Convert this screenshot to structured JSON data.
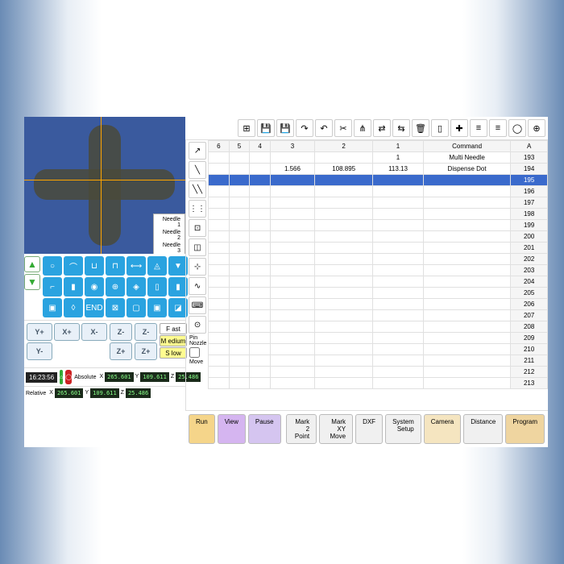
{
  "needle_options": [
    "Needle 1",
    "Needle 2",
    "Needle 3"
  ],
  "columns": {
    "a": "A",
    "cmd": "Command",
    "c1": "1",
    "c2": "2",
    "c3": "3",
    "c4": "4",
    "c5": "5",
    "c6": "6"
  },
  "rows": [
    {
      "n": "193",
      "cmd": "Multi Needle",
      "v1": "1"
    },
    {
      "n": "194",
      "cmd": "Dispense Dot",
      "v1": "113.13",
      "v2": "108.895",
      "v3": "1.566"
    },
    {
      "n": "195",
      "sel": true
    },
    {
      "n": "196"
    },
    {
      "n": "197"
    },
    {
      "n": "198"
    },
    {
      "n": "199"
    },
    {
      "n": "200"
    },
    {
      "n": "201"
    },
    {
      "n": "202"
    },
    {
      "n": "203"
    },
    {
      "n": "204"
    },
    {
      "n": "205"
    },
    {
      "n": "206"
    },
    {
      "n": "207"
    },
    {
      "n": "208"
    },
    {
      "n": "209"
    },
    {
      "n": "210"
    },
    {
      "n": "211"
    },
    {
      "n": "212"
    },
    {
      "n": "213"
    }
  ],
  "jog": {
    "xplus": "X+",
    "xminus": "X-",
    "yplus": "Y+",
    "yminus": "Y-",
    "zplus": "Z+",
    "zminus": "Z-"
  },
  "speed": {
    "f": "F ast",
    "m": "M edium",
    "s": "S low"
  },
  "options": {
    "pin": "Pin Nozzle",
    "move": "Move",
    "rel": "Relative",
    "abs": "Absolute"
  },
  "coords": {
    "x1": "265.601",
    "y1": "109.611",
    "z1": "25.486",
    "x2": "265.601",
    "y2": "109.611",
    "z2": "25.486"
  },
  "clock": "16:23:56",
  "toolbar_icons": [
    "⊕",
    "◯",
    "≡",
    "≡",
    "✚",
    "▯",
    "🗑",
    "⇆",
    "⇄",
    "⋔",
    "✂",
    "↶",
    "↷",
    "💾",
    "💾",
    "⊞"
  ],
  "side_icons": [
    "↗",
    "╲",
    "╲╲",
    "⋮⋮",
    "⊡",
    "◫",
    "⊹",
    "∿",
    "⌨",
    "⊙"
  ],
  "tool_icons": [
    "○",
    "⌒",
    "⊔",
    "⊓",
    "⟷",
    "◬",
    "▼",
    "⌐",
    "▮",
    "◉",
    "⊕",
    "◈",
    "▯",
    "▮",
    "▣",
    "◊",
    "END",
    "⊠",
    "▢",
    "▣",
    "◪"
  ],
  "bottom": {
    "program": "Program",
    "distance": "Distance",
    "setup": "System Setup",
    "dxf": "DXF",
    "mark": "Mark XY Move",
    "mark2": "Mark 2 Point",
    "pause": "Pause",
    "run": "Run",
    "view": "View",
    "camera": "Camera"
  }
}
